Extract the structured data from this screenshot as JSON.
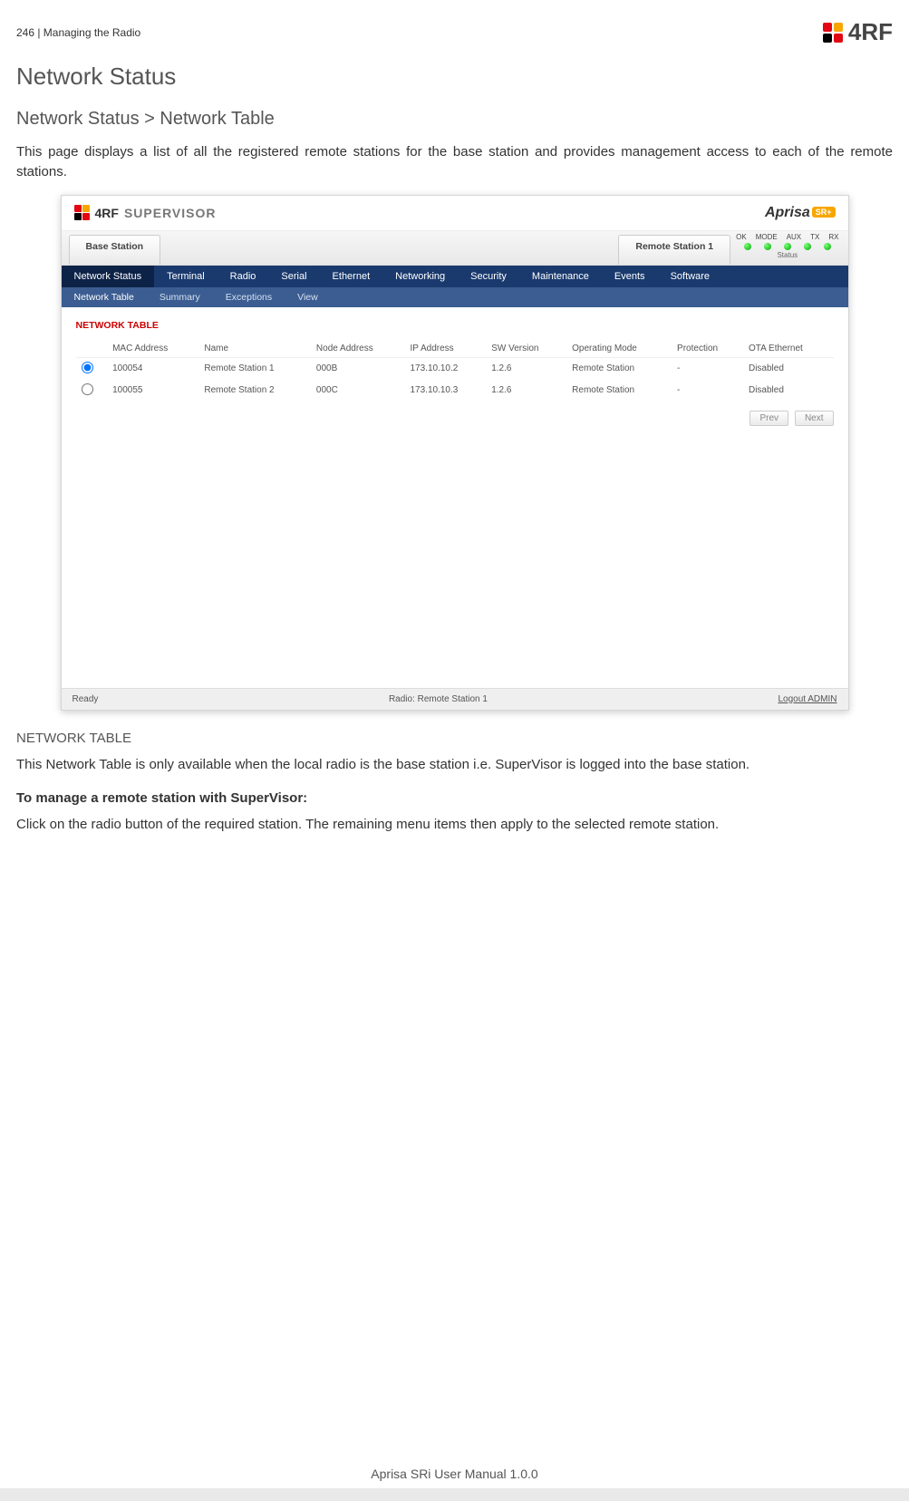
{
  "header": {
    "page_ref": "246  |  Managing the Radio",
    "brand": "4RF"
  },
  "titles": {
    "h1": "Network Status",
    "h2": "Network Status > Network Table"
  },
  "paragraphs": {
    "intro": "This page displays a list of all the registered remote stations for the base station and provides management access to each of the remote stations.",
    "nt_label": "NETWORK TABLE",
    "nt_desc": "This Network Table is only available when the local radio is the base station i.e. SuperVisor is logged into the base station.",
    "howto_title": "To manage a remote station with SuperVisor:",
    "howto_body": "Click on the radio button of the required station. The remaining menu items then apply to the selected remote station."
  },
  "shot": {
    "supervisor_label": "SUPERVISOR",
    "aprisa": "Aprisa",
    "aprisa_pill": "SR+",
    "tabs": {
      "base": "Base Station",
      "remote": "Remote Station 1"
    },
    "leds": [
      "OK",
      "MODE",
      "AUX",
      "TX",
      "RX"
    ],
    "status_label": "Status",
    "nav1": [
      "Network Status",
      "Terminal",
      "Radio",
      "Serial",
      "Ethernet",
      "Networking",
      "Security",
      "Maintenance",
      "Events",
      "Software"
    ],
    "nav2": [
      "Network Table",
      "Summary",
      "Exceptions",
      "View"
    ],
    "panel_title": "NETWORK TABLE",
    "columns": [
      "",
      "MAC Address",
      "Name",
      "Node Address",
      "IP Address",
      "SW Version",
      "Operating Mode",
      "Protection",
      "OTA Ethernet"
    ],
    "rows": [
      {
        "sel": true,
        "mac": "100054",
        "name": "Remote Station 1",
        "node": "000B",
        "ip": "173.10.10.2",
        "sw": "1.2.6",
        "mode": "Remote Station",
        "prot": "-",
        "ota": "Disabled"
      },
      {
        "sel": false,
        "mac": "100055",
        "name": "Remote Station 2",
        "node": "000C",
        "ip": "173.10.10.3",
        "sw": "1.2.6",
        "mode": "Remote Station",
        "prot": "-",
        "ota": "Disabled"
      }
    ],
    "pager": {
      "prev": "Prev",
      "next": "Next"
    },
    "footer": {
      "ready": "Ready",
      "radio": "Radio: Remote Station 1",
      "logout": "Logout ADMIN"
    }
  },
  "footer": {
    "manual": "Aprisa SRi User Manual 1.0.0"
  }
}
